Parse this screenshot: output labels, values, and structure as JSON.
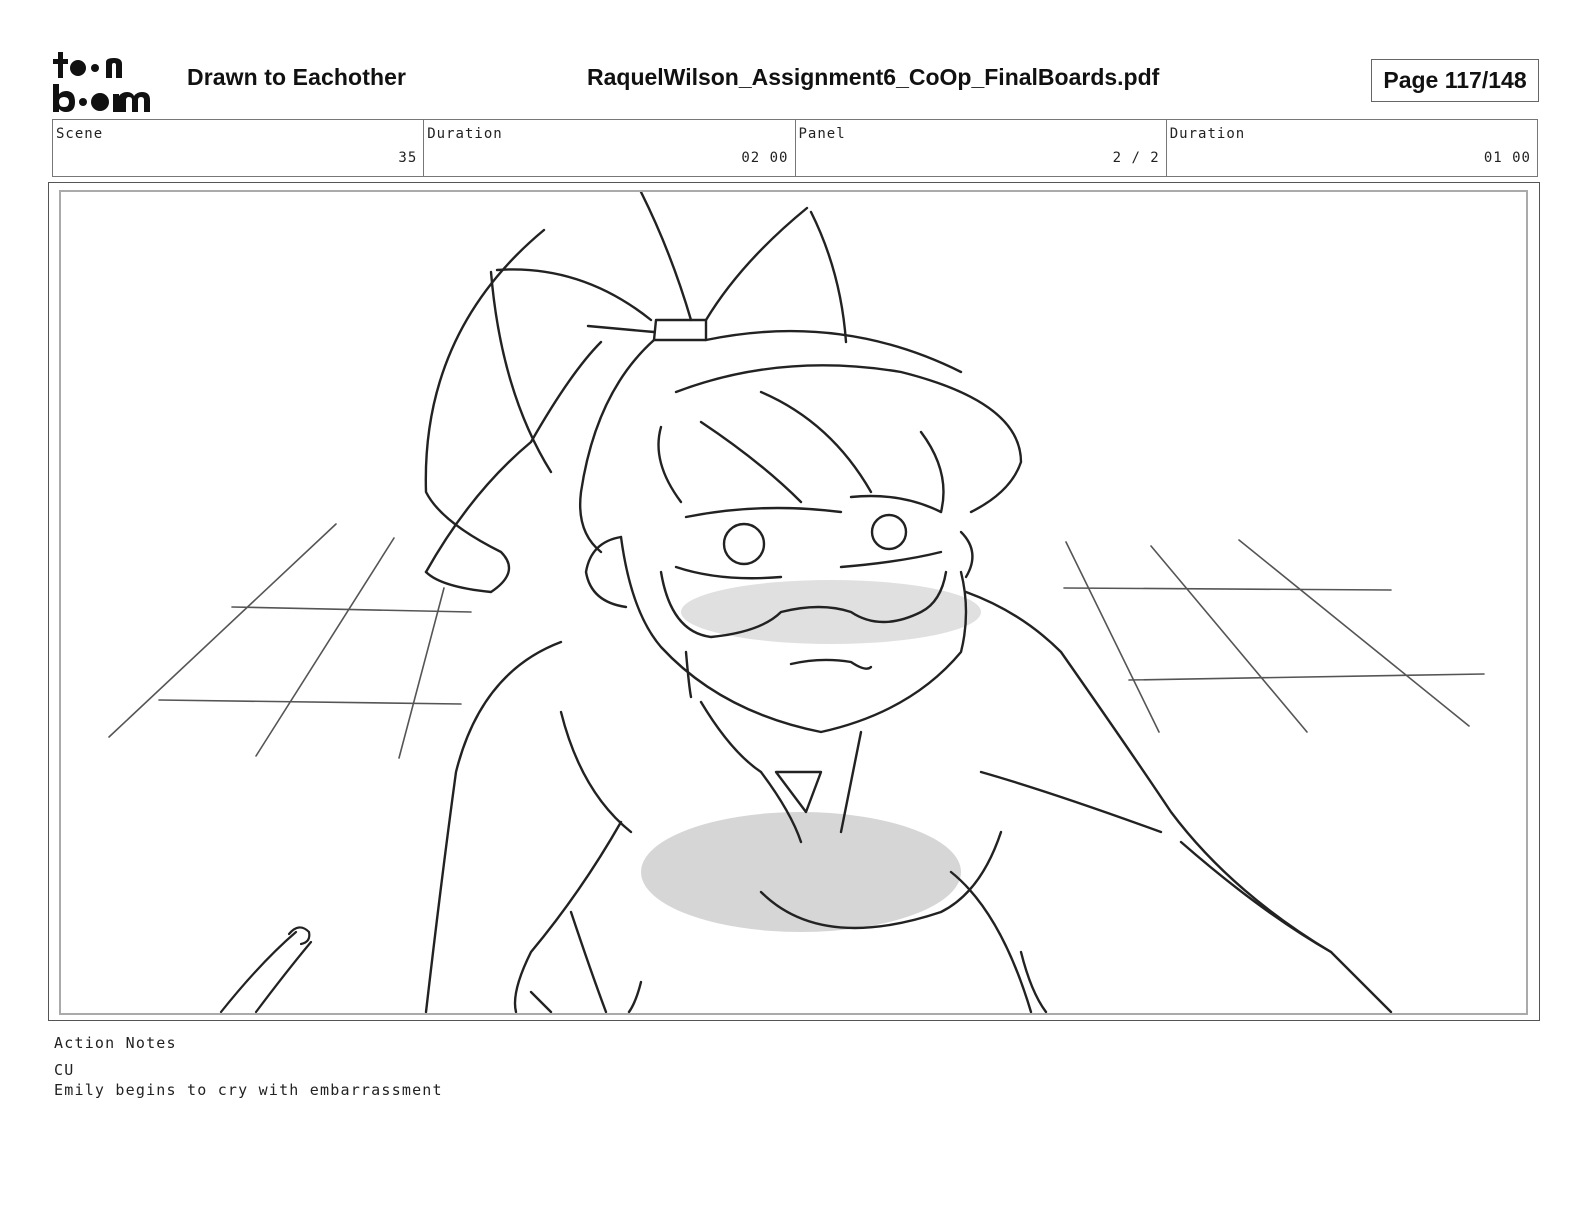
{
  "header": {
    "logo_text": "toon boom",
    "project_title": "Drawn to Eachother",
    "file_name": "RaquelWilson_Assignment6_CoOp_FinalBoards.pdf",
    "page_label": "Page 117/148"
  },
  "info": {
    "scene_label": "Scene",
    "scene_value": "35",
    "scene_duration_label": "Duration",
    "scene_duration_value": "02 00",
    "panel_label": "Panel",
    "panel_value": "2 / 2",
    "panel_duration_label": "Duration",
    "panel_duration_value": "01 00"
  },
  "notes": {
    "label": "Action Notes",
    "lines": [
      "CU",
      "Emily begins to cry with embarrassment"
    ]
  }
}
